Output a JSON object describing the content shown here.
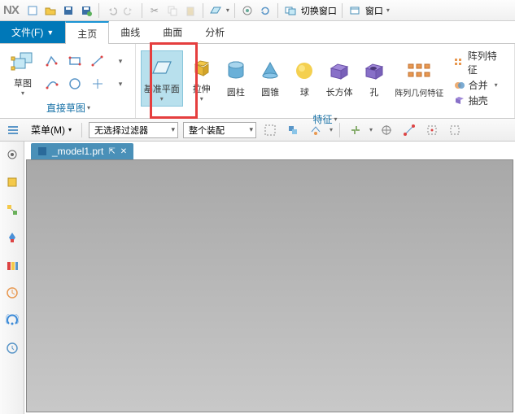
{
  "app": {
    "name": "NX"
  },
  "titlebar": {
    "switch_window": "切换窗口",
    "window": "窗口"
  },
  "menu": {
    "file": "文件(F)",
    "home": "主页",
    "curve": "曲线",
    "surface": "曲面",
    "analyze": "分析"
  },
  "ribbon": {
    "sketch": {
      "label": "草图",
      "group": "直接草图"
    },
    "datum": {
      "label": "基准平面"
    },
    "extrude": {
      "label": "拉伸"
    },
    "cylinder": {
      "label": "圆柱"
    },
    "cone": {
      "label": "圆锥"
    },
    "sphere": {
      "label": "球"
    },
    "block": {
      "label": "长方体"
    },
    "hole": {
      "label": "孔"
    },
    "pattern_geom": {
      "label": "阵列几何特征"
    },
    "feature_group": "特征",
    "pattern_feat": "阵列特征",
    "combine": "合并",
    "shell": "抽壳"
  },
  "selbar": {
    "menu": "菜单(M)",
    "filter": "无选择过滤器",
    "assembly": "整个装配"
  },
  "tab": {
    "name": "_model1.prt"
  }
}
